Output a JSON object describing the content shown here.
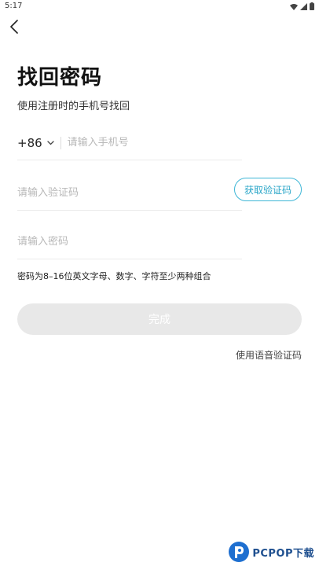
{
  "status_bar": {
    "time": "5:17",
    "icons": [
      "wifi-icon",
      "signal-icon",
      "battery-icon"
    ]
  },
  "nav": {
    "back_icon": "chevron-left-icon"
  },
  "page": {
    "title": "找回密码",
    "subtitle": "使用注册时的手机号找回"
  },
  "phone_field": {
    "country_code": "+86",
    "placeholder": "请输入手机号"
  },
  "code_field": {
    "placeholder": "请输入验证码",
    "get_code_label": "获取验证码"
  },
  "password_field": {
    "placeholder": "请输入密码"
  },
  "hint": "密码为8–16位英文字母、数字、字符至少两种组合",
  "submit_label": "完成",
  "voice_link_label": "使用语音验证码",
  "watermark": {
    "text": "PCPOP下载"
  },
  "colors": {
    "accent": "#3eb6d6",
    "submit_disabled": "#e8e8e8",
    "watermark": "#1e4f8f"
  }
}
